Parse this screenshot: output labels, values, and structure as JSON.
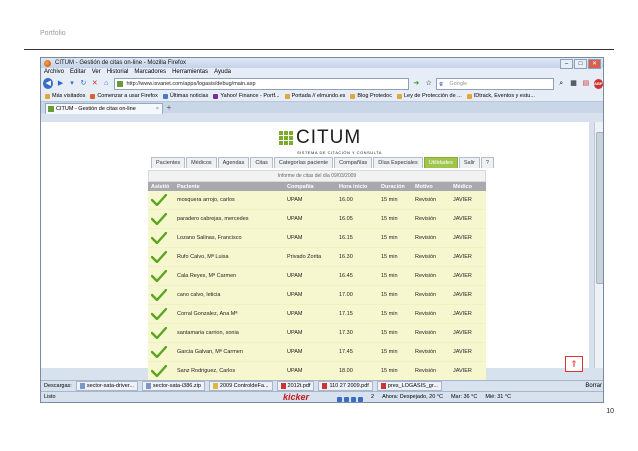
{
  "page": {
    "header": "Portfolio",
    "number": "10"
  },
  "browser": {
    "title": "CITUM - Gestión de citas on-line - Mozilla Firefox",
    "menu": [
      "Archivo",
      "Editar",
      "Ver",
      "Historial",
      "Marcadores",
      "Herramientas",
      "Ayuda"
    ],
    "url": "http://www.isvanet.com/apps/logasis/debug/main.asp",
    "search_placeholder": "Google",
    "bookmarks": [
      "Más visitados",
      "Comenzar a usar Firefox",
      "Últimas noticias",
      "Yahoo! Finance - Portf...",
      "Portada // elmundo.es",
      "Blog Protedoc",
      "Ley de Protección de ...",
      "IDtrack, Eventos y estu..."
    ],
    "tab_label": "CITUM - Gestión de citas on-line",
    "new_tab": "+"
  },
  "app": {
    "logo_text": "CITUM",
    "logo_subtitle": "SISTEMA DE CITACIÓN Y CONSULTA",
    "tabs": [
      "Pacientes",
      "Médicos",
      "Agendas",
      "Citas",
      "Categorías paciente",
      "Compañías",
      "Días Especiales",
      "Utilidades",
      "Salir",
      "?"
    ],
    "active_tab": "Utilidades",
    "report_title": "Informe de citas del día 09/03/2009",
    "columns": [
      "Asistió",
      "Paciente",
      "Compañía",
      "Hora inicio",
      "Duración",
      "Motivo",
      "Médico"
    ],
    "rows": [
      {
        "patient": "mosquera arrojo, carlos",
        "company": "UPAM",
        "start": "16.00",
        "duration": "15 min",
        "reason": "Revisión",
        "doctor": "JAVIER"
      },
      {
        "patient": "paradero cabrejas, mercedes",
        "company": "UPAM",
        "start": "16.05",
        "duration": "15 min",
        "reason": "Revisión",
        "doctor": "JAVIER"
      },
      {
        "patient": "Lozano Salinas, Francisco",
        "company": "UPAM",
        "start": "16.15",
        "duration": "15 min",
        "reason": "Revisión",
        "doctor": "JAVIER"
      },
      {
        "patient": "Rufo Calvo, Mª Luisa",
        "company": "Privado Zorita",
        "start": "16.30",
        "duration": "15 min",
        "reason": "Revisión",
        "doctor": "JAVIER"
      },
      {
        "patient": "Cala Reyes, Mª Carmen",
        "company": "UPAM",
        "start": "16.45",
        "duration": "15 min",
        "reason": "Revisión",
        "doctor": "JAVIER"
      },
      {
        "patient": "cano calvo, leticia",
        "company": "UPAM",
        "start": "17.00",
        "duration": "15 min",
        "reason": "Revisión",
        "doctor": "JAVIER"
      },
      {
        "patient": "Corral Gonzalez, Ana Mª",
        "company": "UPAM",
        "start": "17.15",
        "duration": "15 min",
        "reason": "Revisión",
        "doctor": "JAVIER"
      },
      {
        "patient": "santamaria carrion, sonia",
        "company": "UPAM",
        "start": "17.30",
        "duration": "15 min",
        "reason": "Revisión",
        "doctor": "JAVIER"
      },
      {
        "patient": "Garcia Galvan, Mª Carmen",
        "company": "UPAM",
        "start": "17.45",
        "duration": "15 min",
        "reason": "Revisión",
        "doctor": "JAVIER"
      },
      {
        "patient": "Sanz Rodriguez, Carlos",
        "company": "UPAM",
        "start": "18.00",
        "duration": "15 min",
        "reason": "Revisión",
        "doctor": "JAVIER"
      }
    ]
  },
  "downloads": {
    "label": "Descargas:",
    "items": [
      "sector-sata-driver...",
      "sector-sata-i386.zip",
      "2009 ControldeFa...",
      "2012t.pdf",
      "110 27 2009.pdf",
      "pres_LOGASIS_gr..."
    ],
    "close": "Borrar"
  },
  "status": {
    "left": "Listo",
    "kicker": "kicker",
    "right": [
      "2",
      "Ahora: Despejado, 20 °C",
      "Mar: 36 °C",
      "Mié: 31 °C"
    ]
  },
  "colors": {
    "accent_green": "#9fc54a",
    "row_yellow": "#f7f7cf",
    "header_gray": "#a7a9ac",
    "check_green": "#5aa51e"
  }
}
